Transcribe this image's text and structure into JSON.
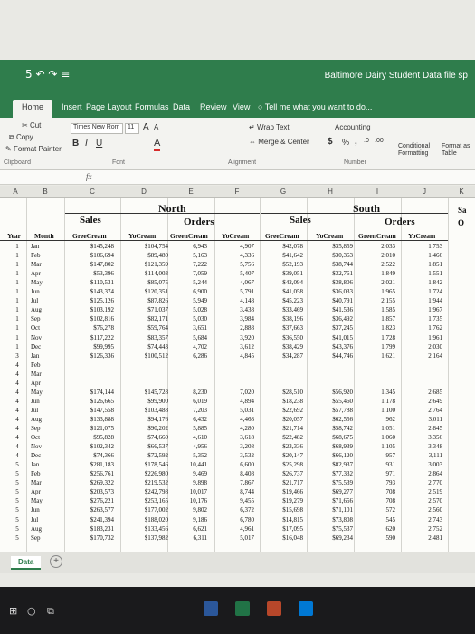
{
  "window": {
    "title": "Baltimore Dairy Student Data file sp",
    "quick_access": "5 ↶ ↷ ≡"
  },
  "ribbon_tabs": [
    "Home",
    "Insert",
    "Page Layout",
    "Formulas",
    "Data",
    "Review",
    "View",
    "Tell me what you want to do..."
  ],
  "ribbon": {
    "cut": "Cut",
    "copy": "Copy",
    "format_painter": "Format Painter",
    "clipboard": "Clipboard",
    "font_name": "Times New Rom",
    "font_size": "11",
    "font_grow": "A",
    "font_shrink": "A",
    "bold": "B",
    "italic": "I",
    "underline": "U",
    "font_color": "A",
    "font_group": "Font",
    "wrap_text": "Wrap Text",
    "merge_center": "Merge & Center",
    "alignment_group": "Alignment",
    "number_format": "Accounting",
    "currency": "$",
    "percent": "%",
    "comma": ",",
    "dec_more": ".0",
    "dec_less": ".00",
    "number_group": "Number",
    "conditional": "Conditional Formatting",
    "format_as": "Format as Table",
    "fx": "fx"
  },
  "columns": [
    "A",
    "B",
    "C",
    "D",
    "E",
    "F",
    "G",
    "H",
    "I",
    "J",
    "K"
  ],
  "sheet": {
    "north": "North",
    "south": "South",
    "sales": "Sales",
    "orders": "Orders",
    "year": "Year",
    "month": "Month",
    "greencream": "GreeCream",
    "yocream": "YoCream",
    "greencream_orders": "GreenCream",
    "edge_label_1": "Sa",
    "edge_label_2": "O",
    "rows": [
      [
        "1",
        "Jan",
        "$145,248",
        "$104,754",
        "6,943",
        "4,907",
        "$42,078",
        "$35,859",
        "2,033",
        "1,753"
      ],
      [
        "1",
        "Feb",
        "$106,694",
        "$89,480",
        "5,163",
        "4,336",
        "$41,642",
        "$30,363",
        "2,010",
        "1,466"
      ],
      [
        "1",
        "Mar",
        "$147,802",
        "$121,359",
        "7,222",
        "5,756",
        "$52,193",
        "$38,744",
        "2,522",
        "1,851"
      ],
      [
        "1",
        "Apr",
        "$53,396",
        "$114,003",
        "7,059",
        "5,407",
        "$39,051",
        "$32,761",
        "1,849",
        "1,551"
      ],
      [
        "1",
        "May",
        "$110,531",
        "$85,075",
        "5,244",
        "4,067",
        "$42,094",
        "$38,806",
        "2,021",
        "1,842"
      ],
      [
        "1",
        "Jun",
        "$143,374",
        "$120,351",
        "6,900",
        "5,791",
        "$41,058",
        "$36,033",
        "1,965",
        "1,724"
      ],
      [
        "1",
        "Jul",
        "$125,126",
        "$87,826",
        "5,949",
        "4,148",
        "$45,223",
        "$40,791",
        "2,155",
        "1,944"
      ],
      [
        "1",
        "Aug",
        "$103,192",
        "$71,037",
        "5,028",
        "3,438",
        "$33,469",
        "$41,536",
        "1,585",
        "1,967"
      ],
      [
        "1",
        "Sep",
        "$102,816",
        "$82,171",
        "5,030",
        "3,984",
        "$38,196",
        "$36,492",
        "1,857",
        "1,735"
      ],
      [
        "1",
        "Oct",
        "$76,278",
        "$59,764",
        "3,651",
        "2,888",
        "$37,663",
        "$37,245",
        "1,823",
        "1,762"
      ],
      [
        "1",
        "Nov",
        "$117,222",
        "$83,357",
        "5,684",
        "3,920",
        "$36,550",
        "$41,015",
        "1,728",
        "1,961"
      ],
      [
        "1",
        "Dec",
        "$99,995",
        "$74,443",
        "4,702",
        "3,612",
        "$38,429",
        "$43,376",
        "1,799",
        "2,030"
      ],
      [
        "3",
        "Jan",
        "$126,336",
        "$100,512",
        "6,286",
        "4,845",
        "$34,287",
        "$44,746",
        "1,621",
        "2,164"
      ],
      [
        "4",
        "Feb",
        "",
        "",
        "",
        "",
        "",
        "",
        "",
        ""
      ],
      [
        "4",
        "Mar",
        "",
        "",
        "",
        "",
        "",
        "",
        "",
        ""
      ],
      [
        "4",
        "Apr",
        "",
        "",
        "",
        "",
        "",
        "",
        "",
        ""
      ],
      [
        "4",
        "May",
        "$174,144",
        "$145,728",
        "8,230",
        "7,020",
        "$28,510",
        "$56,920",
        "1,345",
        "2,685"
      ],
      [
        "4",
        "Jun",
        "$126,665",
        "$99,900",
        "6,019",
        "4,894",
        "$18,238",
        "$55,460",
        "1,178",
        "2,649"
      ],
      [
        "4",
        "Jul",
        "$147,558",
        "$103,488",
        "7,203",
        "5,031",
        "$22,692",
        "$57,788",
        "1,100",
        "2,764"
      ],
      [
        "4",
        "Aug",
        "$133,888",
        "$94,176",
        "6,432",
        "4,468",
        "$20,057",
        "$62,556",
        "962",
        "3,011"
      ],
      [
        "4",
        "Sep",
        "$121,075",
        "$90,202",
        "5,885",
        "4,280",
        "$21,714",
        "$58,742",
        "1,051",
        "2,845"
      ],
      [
        "4",
        "Oct",
        "$95,828",
        "$74,660",
        "4,610",
        "3,618",
        "$22,482",
        "$68,675",
        "1,060",
        "3,356"
      ],
      [
        "4",
        "Nov",
        "$102,342",
        "$66,537",
        "4,956",
        "3,208",
        "$23,336",
        "$68,939",
        "1,105",
        "3,348"
      ],
      [
        "4",
        "Dec",
        "$74,366",
        "$72,592",
        "5,352",
        "3,532",
        "$20,147",
        "$66,120",
        "957",
        "3,111"
      ],
      [
        "5",
        "Jan",
        "$281,183",
        "$178,546",
        "10,441",
        "6,600",
        "$25,298",
        "$82,937",
        "931",
        "3,003"
      ],
      [
        "5",
        "Feb",
        "$256,761",
        "$226,980",
        "9,469",
        "8,408",
        "$26,737",
        "$77,332",
        "971",
        "2,864"
      ],
      [
        "5",
        "Mar",
        "$269,322",
        "$219,532",
        "9,898",
        "7,867",
        "$21,717",
        "$75,539",
        "793",
        "2,770"
      ],
      [
        "5",
        "Apr",
        "$203,573",
        "$242,798",
        "10,017",
        "8,744",
        "$19,466",
        "$69,277",
        "708",
        "2,519"
      ],
      [
        "5",
        "May",
        "$276,221",
        "$253,165",
        "10,176",
        "9,455",
        "$19,279",
        "$71,656",
        "708",
        "2,570"
      ],
      [
        "5",
        "Jun",
        "$263,577",
        "$177,002",
        "9,802",
        "6,372",
        "$15,698",
        "$71,101",
        "572",
        "2,560"
      ],
      [
        "5",
        "Jul",
        "$241,394",
        "$188,020",
        "9,186",
        "6,780",
        "$14,815",
        "$73,808",
        "545",
        "2,743"
      ],
      [
        "5",
        "Aug",
        "$183,231",
        "$133,456",
        "6,621",
        "4,961",
        "$17,095",
        "$75,537",
        "620",
        "2,752"
      ],
      [
        "5",
        "Sep",
        "$170,732",
        "$137,982",
        "6,311",
        "5,017",
        "$16,048",
        "$69,234",
        "590",
        "2,481"
      ]
    ]
  },
  "sheet_tab": "Data",
  "add_sheet": "+",
  "taskbar": {
    "search": "○",
    "taskview": "⧉"
  }
}
